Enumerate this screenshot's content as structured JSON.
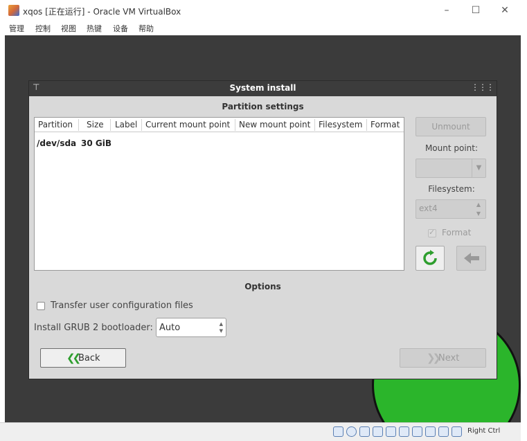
{
  "window": {
    "title": "xqos [正在运行] - Oracle VM VirtualBox",
    "menu": [
      "管理",
      "控制",
      "视图",
      "热键",
      "设备",
      "帮助"
    ]
  },
  "dialog": {
    "title": "System install",
    "partition_heading": "Partition settings",
    "columns": [
      "Partition",
      "Size",
      "Label",
      "Current mount point",
      "New mount point",
      "Filesystem",
      "Format"
    ],
    "rows": [
      {
        "partition": "/dev/sda",
        "size": "30 GiB"
      }
    ],
    "unmount_label": "Unmount",
    "mount_point_label": "Mount point:",
    "mount_point_value": "",
    "filesystem_label": "Filesystem:",
    "filesystem_value": "ext4",
    "format_label": "Format",
    "format_checked": true,
    "options_heading": "Options",
    "transfer_label": "Transfer user configuration files",
    "transfer_checked": false,
    "grub_label": "Install GRUB 2 bootloader:",
    "grub_value": "Auto",
    "back_label": "Back",
    "next_label": "Next"
  },
  "statusbar": {
    "host_key": "Right Ctrl"
  },
  "colors": {
    "refresh_green": "#2e9e2e",
    "title_bar": "#3c3c3c",
    "dialog_bg": "#d9d9d9"
  }
}
